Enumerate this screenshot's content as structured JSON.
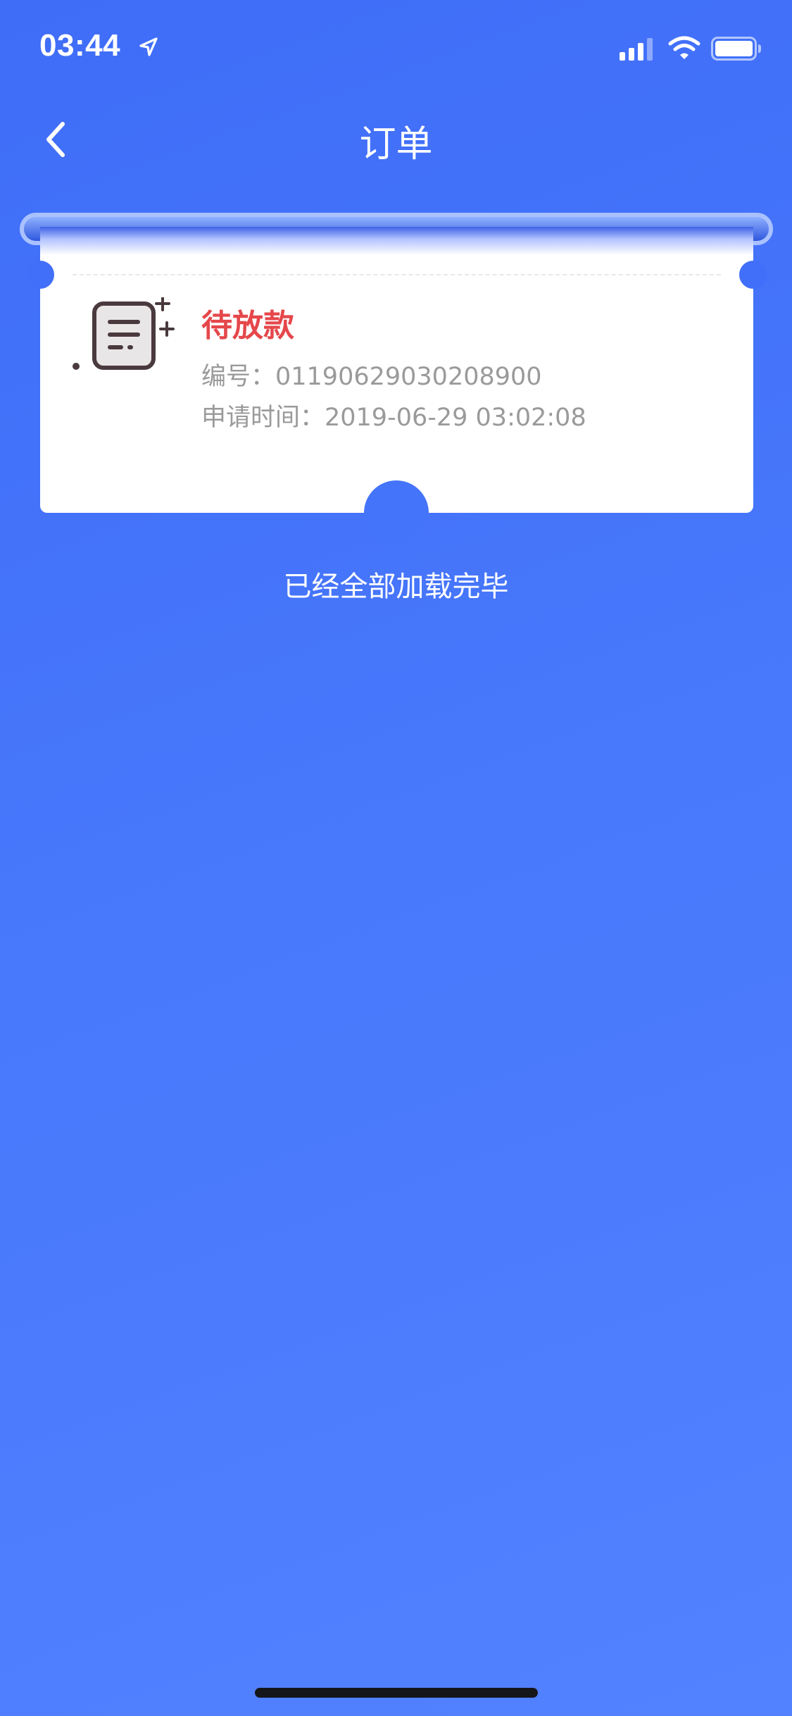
{
  "status_bar": {
    "time": "03:44",
    "icons": [
      "location-arrow-icon",
      "signal-icon",
      "wifi-icon",
      "battery-icon"
    ]
  },
  "nav": {
    "title": "订单",
    "back_icon": "chevron-left-icon"
  },
  "order": {
    "status": "待放款",
    "number_line": "编号：01190629030208900",
    "apply_time_line": "申请时间：2019-06-29 03:02:08",
    "icon": "document-icon"
  },
  "list_footer": "已经全部加载完毕",
  "colors": {
    "background": "#4275fa",
    "status_red": "#e5474b",
    "info_gray": "#9a9a9a",
    "card": "#ffffff"
  }
}
